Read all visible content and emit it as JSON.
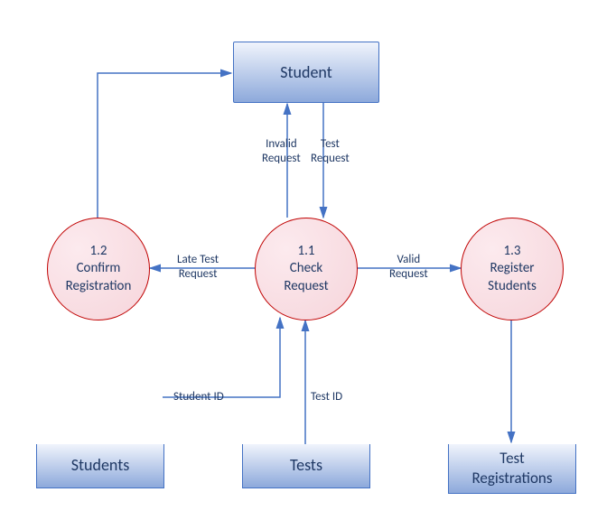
{
  "entity": {
    "student": "Student"
  },
  "processes": {
    "checkRequest": {
      "id": "1.1",
      "name": "Check\nRequest"
    },
    "confirmRegistration": {
      "id": "1.2",
      "name": "Confirm\nRegistration"
    },
    "registerStudents": {
      "id": "1.3",
      "name": "Register\nStudents"
    }
  },
  "stores": {
    "students": "Students",
    "tests": "Tests",
    "testRegistrations": "Test\nRegistrations"
  },
  "flows": {
    "invalidRequest": "Invalid\nRequest",
    "testRequest": "Test\nRequest",
    "lateTestRequest": "Late Test\nRequest",
    "validRequest": "Valid\nRequest",
    "studentId": "Student ID",
    "testId": "Test ID"
  }
}
